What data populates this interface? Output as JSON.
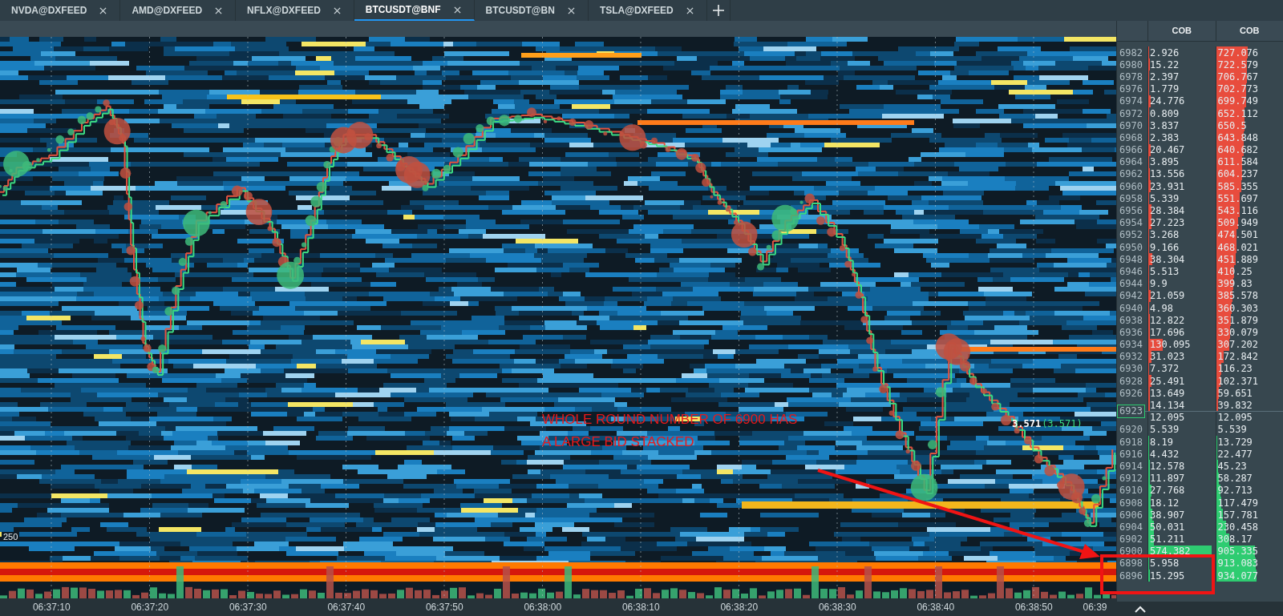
{
  "tabs": [
    {
      "label": "NVDA@DXFEED",
      "selected": false
    },
    {
      "label": "AMD@DXFEED",
      "selected": false
    },
    {
      "label": "NFLX@DXFEED",
      "selected": false
    },
    {
      "label": "BTCUSDT@BNF",
      "selected": true
    },
    {
      "label": "BTCUSDT@BN",
      "selected": false
    },
    {
      "label": "TSLA@DXFEED",
      "selected": false
    }
  ],
  "chart": {
    "scale_label": "250",
    "last_trade": {
      "size": "3.571",
      "total": "(3.571)"
    },
    "annotation": {
      "lines": [
        "WHOLE ROUND NUMBER OF 6900 HAS",
        "A LARGE BID STACKED"
      ]
    },
    "time_labels": [
      "06:37:10",
      "06:37:20",
      "06:37:30",
      "06:37:40",
      "06:37:50",
      "06:38:00",
      "06:38:10",
      "06:38:20",
      "06:38:30",
      "06:38:40",
      "06:38:50",
      "06:39"
    ]
  },
  "ladder": {
    "columns": [
      "COB",
      "COB"
    ],
    "rows": [
      {
        "price": "6982",
        "color": "#e84c3d",
        "volume": {
          "text": "2.926",
          "level": 0.005
        },
        "cob": {
          "text": "727.076",
          "level": 0.469
        }
      },
      {
        "price": "6980",
        "color": "#e84c3d",
        "volume": {
          "text": "15.22",
          "level": 0.025
        },
        "cob": {
          "text": "722.579",
          "level": 0.466
        }
      },
      {
        "price": "6978",
        "color": "#e84c3d",
        "volume": {
          "text": "2.397",
          "level": 0.004
        },
        "cob": {
          "text": "706.767",
          "level": 0.456
        }
      },
      {
        "price": "6976",
        "color": "#e84c3d",
        "volume": {
          "text": "1.779",
          "level": 0.003
        },
        "cob": {
          "text": "702.773",
          "level": 0.453
        }
      },
      {
        "price": "6974",
        "color": "#e84c3d",
        "volume": {
          "text": "24.776",
          "level": 0.041
        },
        "cob": {
          "text": "699.749",
          "level": 0.451
        }
      },
      {
        "price": "6972",
        "color": "#e84c3d",
        "volume": {
          "text": "0.809",
          "level": 0.001
        },
        "cob": {
          "text": "652.112",
          "level": 0.421
        }
      },
      {
        "price": "6970",
        "color": "#e84c3d",
        "volume": {
          "text": "3.837",
          "level": 0.006
        },
        "cob": {
          "text": "650.5",
          "level": 0.42
        }
      },
      {
        "price": "6968",
        "color": "#e84c3d",
        "volume": {
          "text": "2.383",
          "level": 0.004
        },
        "cob": {
          "text": "643.848",
          "level": 0.415
        }
      },
      {
        "price": "6966",
        "color": "#e84c3d",
        "volume": {
          "text": "20.467",
          "level": 0.034
        },
        "cob": {
          "text": "640.682",
          "level": 0.413
        }
      },
      {
        "price": "6964",
        "color": "#e84c3d",
        "volume": {
          "text": "3.895",
          "level": 0.006
        },
        "cob": {
          "text": "611.584",
          "level": 0.395
        }
      },
      {
        "price": "6962",
        "color": "#e84c3d",
        "volume": {
          "text": "13.556",
          "level": 0.022
        },
        "cob": {
          "text": "604.237",
          "level": 0.39
        }
      },
      {
        "price": "6960",
        "color": "#e84c3d",
        "volume": {
          "text": "23.931",
          "level": 0.04
        },
        "cob": {
          "text": "585.355",
          "level": 0.378
        }
      },
      {
        "price": "6958",
        "color": "#e84c3d",
        "volume": {
          "text": "5.339",
          "level": 0.009
        },
        "cob": {
          "text": "551.697",
          "level": 0.356
        }
      },
      {
        "price": "6956",
        "color": "#e84c3d",
        "volume": {
          "text": "28.384",
          "level": 0.047
        },
        "cob": {
          "text": "543.116",
          "level": 0.35
        }
      },
      {
        "price": "6954",
        "color": "#e84c3d",
        "volume": {
          "text": "27.223",
          "level": 0.045
        },
        "cob": {
          "text": "509.949",
          "level": 0.329
        }
      },
      {
        "price": "6952",
        "color": "#e84c3d",
        "volume": {
          "text": "3.268",
          "level": 0.005
        },
        "cob": {
          "text": "474.501",
          "level": 0.306
        }
      },
      {
        "price": "6950",
        "color": "#e84c3d",
        "volume": {
          "text": "9.166",
          "level": 0.015
        },
        "cob": {
          "text": "468.021",
          "level": 0.302
        }
      },
      {
        "price": "6948",
        "color": "#e84c3d",
        "volume": {
          "text": "38.304",
          "level": 0.063
        },
        "cob": {
          "text": "451.889",
          "level": 0.292
        }
      },
      {
        "price": "6946",
        "color": "#e84c3d",
        "volume": {
          "text": "5.513",
          "level": 0.009
        },
        "cob": {
          "text": "410.25",
          "level": 0.265
        }
      },
      {
        "price": "6944",
        "color": "#e84c3d",
        "volume": {
          "text": "9.9",
          "level": 0.016
        },
        "cob": {
          "text": "399.83",
          "level": 0.258
        }
      },
      {
        "price": "6942",
        "color": "#e84c3d",
        "volume": {
          "text": "21.059",
          "level": 0.035
        },
        "cob": {
          "text": "385.578",
          "level": 0.249
        }
      },
      {
        "price": "6940",
        "color": "#e84c3d",
        "volume": {
          "text": "4.98",
          "level": 0.008
        },
        "cob": {
          "text": "360.303",
          "level": 0.232
        }
      },
      {
        "price": "6938",
        "color": "#e84c3d",
        "volume": {
          "text": "12.822",
          "level": 0.021
        },
        "cob": {
          "text": "351.879",
          "level": 0.227
        }
      },
      {
        "price": "6936",
        "color": "#e84c3d",
        "volume": {
          "text": "17.696",
          "level": 0.029
        },
        "cob": {
          "text": "330.079",
          "level": 0.213
        }
      },
      {
        "price": "6934",
        "color": "#e84c3d",
        "volume": {
          "text": "130.095",
          "level": 0.215
        },
        "cob": {
          "text": "307.202",
          "level": 0.198
        }
      },
      {
        "price": "6932",
        "color": "#e84c3d",
        "volume": {
          "text": "31.023",
          "level": 0.051
        },
        "cob": {
          "text": "172.842",
          "level": 0.112
        }
      },
      {
        "price": "6930",
        "color": "#e84c3d",
        "volume": {
          "text": "7.372",
          "level": 0.012
        },
        "cob": {
          "text": "116.23",
          "level": 0.075
        }
      },
      {
        "price": "6928",
        "color": "#e84c3d",
        "volume": {
          "text": "25.491",
          "level": 0.042
        },
        "cob": {
          "text": "102.371",
          "level": 0.066
        }
      },
      {
        "price": "6926",
        "color": "#e84c3d",
        "volume": {
          "text": "13.649",
          "level": 0.023
        },
        "cob": {
          "text": "59.651",
          "level": 0.038
        }
      },
      {
        "marker": "6923",
        "color": "#e84c3d",
        "volume": {
          "text": "14.134",
          "level": 0.023
        },
        "cob": {
          "text": "39.832",
          "level": 0.026
        }
      },
      {
        "volume": {
          "text": "12.095"
        },
        "cob": {
          "text": "12.095"
        }
      },
      {
        "price": "6920",
        "volume": {
          "text": "5.539"
        },
        "cob": {
          "text": "5.539"
        }
      },
      {
        "price": "6918",
        "color": "#2ecc71",
        "volume": {
          "text": "8.19",
          "level": 0.014
        },
        "cob": {
          "text": "13.729",
          "level": 0.009
        }
      },
      {
        "price": "6916",
        "color": "#2ecc71",
        "volume": {
          "text": "4.432",
          "level": 0.007
        },
        "cob": {
          "text": "22.477",
          "level": 0.015
        }
      },
      {
        "price": "6914",
        "color": "#2ecc71",
        "volume": {
          "text": "12.578",
          "level": 0.021
        },
        "cob": {
          "text": "45.23",
          "level": 0.029
        }
      },
      {
        "price": "6912",
        "color": "#2ecc71",
        "volume": {
          "text": "11.897",
          "level": 0.02
        },
        "cob": {
          "text": "58.287",
          "level": 0.038
        }
      },
      {
        "price": "6910",
        "color": "#2ecc71",
        "volume": {
          "text": "27.768",
          "level": 0.046
        },
        "cob": {
          "text": "92.713",
          "level": 0.06
        }
      },
      {
        "price": "6908",
        "color": "#2ecc71",
        "volume": {
          "text": "18.12",
          "level": 0.03
        },
        "cob": {
          "text": "117.479",
          "level": 0.076
        }
      },
      {
        "price": "6906",
        "color": "#2ecc71",
        "volume": {
          "text": "38.907",
          "level": 0.064
        },
        "cob": {
          "text": "157.781",
          "level": 0.102
        }
      },
      {
        "price": "6904",
        "color": "#2ecc71",
        "volume": {
          "text": "50.031",
          "level": 0.083
        },
        "cob": {
          "text": "230.458",
          "level": 0.149
        }
      },
      {
        "price": "6902",
        "color": "#2ecc71",
        "volume": {
          "text": "51.211",
          "level": 0.085
        },
        "cob": {
          "text": "308.17",
          "level": 0.199
        }
      },
      {
        "price": "6900",
        "color": "#2ecc71",
        "volume": {
          "text": "574.382",
          "level": 0.949
        },
        "cob": {
          "text": "905.335",
          "level": 0.584
        }
      },
      {
        "price": "6898",
        "color": "#2ecc71",
        "volume": {
          "text": "5.958",
          "level": 0.01
        },
        "cob": {
          "text": "913.083",
          "level": 0.589
        }
      },
      {
        "price": "6896",
        "color": "#2ecc71",
        "volume": {
          "text": "15.295",
          "level": 0.025
        },
        "cob": {
          "text": "934.077",
          "level": 0.603
        }
      }
    ]
  }
}
